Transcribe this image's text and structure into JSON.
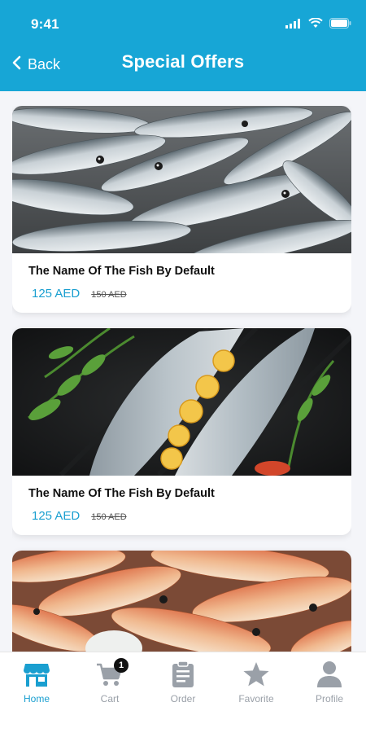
{
  "status_bar": {
    "time": "9:41"
  },
  "header": {
    "back_label": "Back",
    "title": "Special Offers"
  },
  "offers": [
    {
      "name": "The Name Of The Fish By Default",
      "price": "125 AED",
      "old_price": "150 AED",
      "image": "sardines-pile"
    },
    {
      "name": "The Name Of The Fish By Default",
      "price": "125 AED",
      "old_price": "150 AED",
      "image": "sea-bass-with-lemon-and-herbs"
    },
    {
      "name": "",
      "price": "",
      "old_price": "",
      "image": "red-snapper-pile"
    }
  ],
  "bottom_nav": [
    {
      "label": "Home",
      "icon": "store-icon",
      "active": true
    },
    {
      "label": "Cart",
      "icon": "cart-icon",
      "badge": "1"
    },
    {
      "label": "Order",
      "icon": "clipboard-icon"
    },
    {
      "label": "Favorite",
      "icon": "star-icon"
    },
    {
      "label": "Profile",
      "icon": "user-icon"
    }
  ],
  "colors": {
    "accent": "#17a6d6",
    "price": "#1a9fd0",
    "inactive": "#9aa0a8"
  }
}
